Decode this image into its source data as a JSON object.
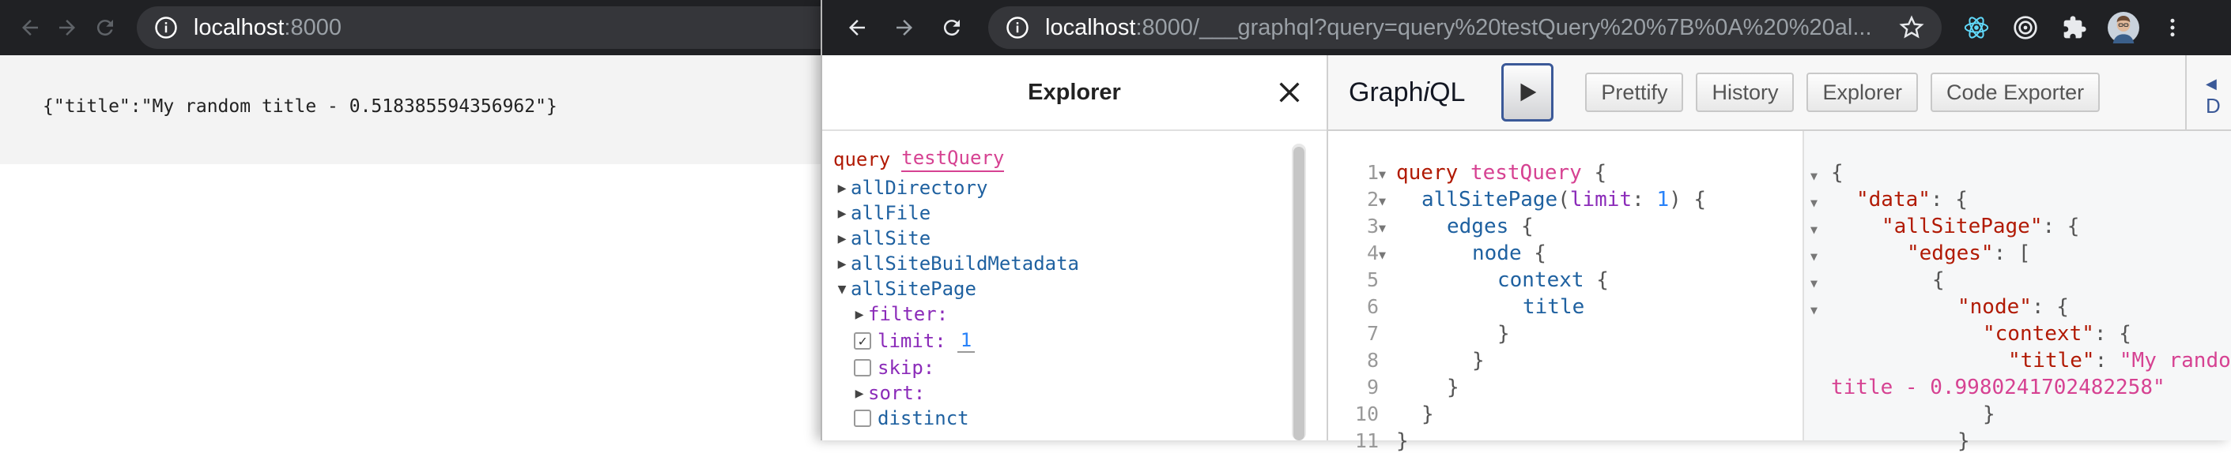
{
  "left_window": {
    "url_host": "localhost",
    "url_port": ":8000",
    "content": "{\"title\":\"My random title - 0.518385594356962\"}"
  },
  "right_window": {
    "url_host": "localhost",
    "url_rest": ":8000/___graphql?query=query%20testQuery%20%7B%0A%20%20al..."
  },
  "explorer": {
    "title": "Explorer",
    "query_keyword": "query",
    "query_name": "testQuery",
    "fields": [
      "allDirectory",
      "allFile",
      "allSite",
      "allSiteBuildMetadata"
    ],
    "expanded_field": "allSitePage",
    "args": {
      "filter": "filter:",
      "limit": "limit:",
      "limit_value": "1",
      "skip": "skip:",
      "sort": "sort:"
    },
    "subfield": "distinct"
  },
  "graphiql": {
    "title_pre": "Graph",
    "title_i": "i",
    "title_post": "QL",
    "buttons": [
      "Prettify",
      "History",
      "Explorer",
      "Code Exporter"
    ],
    "docs_label": "D",
    "line_numbers": [
      "1",
      "2",
      "3",
      "4",
      "5",
      "6",
      "7",
      "8",
      "9",
      "10",
      "11"
    ],
    "code": {
      "l1_kw": "query",
      "l1_name": "testQuery",
      "l2_field": "allSitePage",
      "l2_arg": "limit",
      "l2_val": "1",
      "l3": "edges",
      "l4": "node",
      "l5": "context",
      "l6": "title"
    },
    "result": {
      "data_key": "\"data\"",
      "allSitePage_key": "\"allSitePage\"",
      "edges_key": "\"edges\"",
      "node_key": "\"node\"",
      "context_key": "\"context\"",
      "title_key": "\"title\"",
      "title_value_1": "\"My random",
      "title_value_2": "title - 0.9980241702482258\""
    }
  }
}
